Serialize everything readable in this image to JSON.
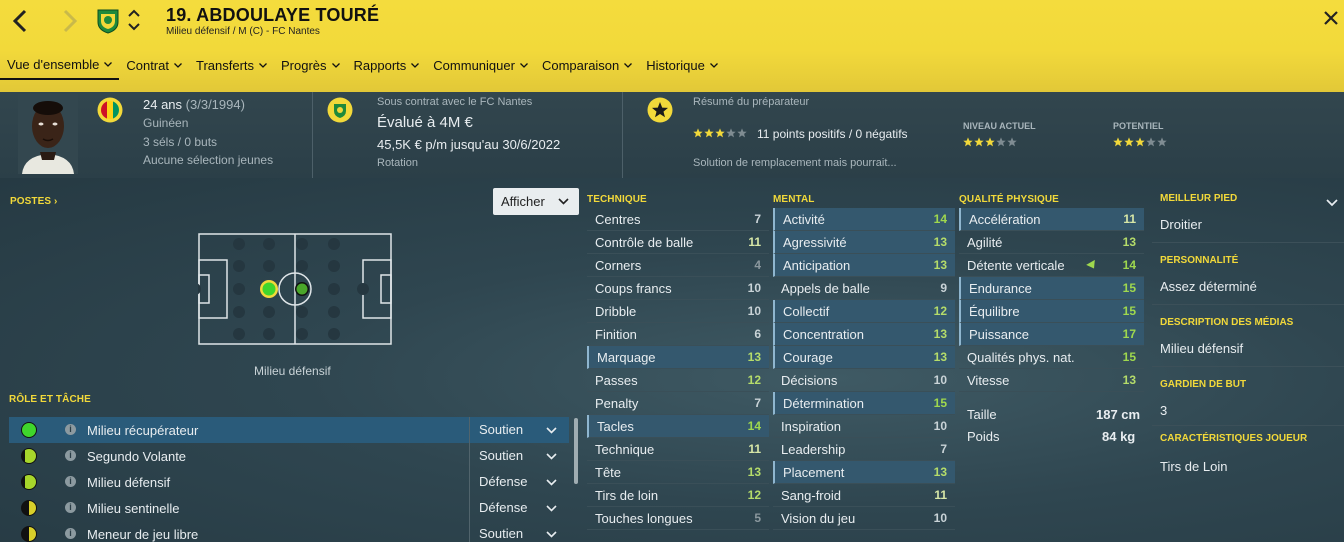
{
  "header": {
    "player_name": "19. ABDOULAYE TOURÉ",
    "player_sub": "Milieu défensif / M (C) - FC Nantes",
    "icons": {
      "back": "chevron-left-icon",
      "forward": "chevron-right-icon",
      "crest": "fc-nantes-crest-icon",
      "updown": "up-down-arrows-icon",
      "close": "close-icon"
    },
    "accent_color": "#f2d93a"
  },
  "menu": [
    {
      "label": "Vue d'ensemble",
      "active": true
    },
    {
      "label": "Contrat"
    },
    {
      "label": "Transferts"
    },
    {
      "label": "Progrès"
    },
    {
      "label": "Rapports"
    },
    {
      "label": "Communiquer"
    },
    {
      "label": "Comparaison"
    },
    {
      "label": "Historique"
    }
  ],
  "info": {
    "age_main": "24 ans",
    "age_dob": "(3/3/1994)",
    "nationality": "Guinéen",
    "caps": "3 séls / 0 buts",
    "youth": "Aucune sélection jeunes",
    "contract_with": "Sous contrat avec le FC Nantes",
    "value": "Évalué à 4M €",
    "wage": "45,5K € p/m jusqu'au 30/6/2022",
    "squad_status": "Rotation",
    "report_title": "Résumé du préparateur",
    "report_stars": 3,
    "report_points": "11 points positifs / 0 négatifs",
    "report_summary": "Solution de remplacement mais pourrait...",
    "current_label": "NIVEAU ACTUEL",
    "current_stars": 3,
    "potential_label": "POTENTIEL",
    "potential_stars": 3
  },
  "positions": {
    "title": "POSTES",
    "show_button": "Afficher",
    "position_label": "Milieu défensif"
  },
  "roles": {
    "title": "RÔLE ET TÂCHE",
    "items": [
      {
        "name": "Milieu récupérateur",
        "duty": "Soutien",
        "selected": true,
        "rating": "full"
      },
      {
        "name": "Segundo Volante",
        "duty": "Soutien",
        "rating": "high"
      },
      {
        "name": "Milieu défensif",
        "duty": "Défense",
        "rating": "high"
      },
      {
        "name": "Milieu sentinelle",
        "duty": "Défense",
        "rating": "half"
      },
      {
        "name": "Meneur de jeu libre",
        "duty": "Soutien",
        "rating": "half"
      }
    ]
  },
  "technique": {
    "title": "TECHNIQUE",
    "items": [
      {
        "name": "Centres",
        "value": 7
      },
      {
        "name": "Contrôle de balle",
        "value": 11
      },
      {
        "name": "Corners",
        "value": 4
      },
      {
        "name": "Coups francs",
        "value": 10
      },
      {
        "name": "Dribble",
        "value": 10
      },
      {
        "name": "Finition",
        "value": 6
      },
      {
        "name": "Marquage",
        "value": 13,
        "highlight": true
      },
      {
        "name": "Passes",
        "value": 12
      },
      {
        "name": "Penalty",
        "value": 7
      },
      {
        "name": "Tacles",
        "value": 14,
        "highlight": true
      },
      {
        "name": "Technique",
        "value": 11
      },
      {
        "name": "Tête",
        "value": 13
      },
      {
        "name": "Tirs de loin",
        "value": 12
      },
      {
        "name": "Touches longues",
        "value": 5
      }
    ]
  },
  "mental": {
    "title": "MENTAL",
    "items": [
      {
        "name": "Activité",
        "value": 14,
        "highlight": true
      },
      {
        "name": "Agressivité",
        "value": 13,
        "highlight": true
      },
      {
        "name": "Anticipation",
        "value": 13,
        "highlight": true
      },
      {
        "name": "Appels de balle",
        "value": 9
      },
      {
        "name": "Collectif",
        "value": 12,
        "highlight": true
      },
      {
        "name": "Concentration",
        "value": 13,
        "highlight": true
      },
      {
        "name": "Courage",
        "value": 13,
        "highlight": true
      },
      {
        "name": "Décisions",
        "value": 10
      },
      {
        "name": "Détermination",
        "value": 15,
        "highlight": true
      },
      {
        "name": "Inspiration",
        "value": 10
      },
      {
        "name": "Leadership",
        "value": 7
      },
      {
        "name": "Placement",
        "value": 13,
        "highlight": true
      },
      {
        "name": "Sang-froid",
        "value": 11
      },
      {
        "name": "Vision du jeu",
        "value": 10
      }
    ]
  },
  "physical": {
    "title": "QUALITÉ PHYSIQUE",
    "items": [
      {
        "name": "Accélération",
        "value": 11,
        "highlight": true
      },
      {
        "name": "Agilité",
        "value": 13
      },
      {
        "name": "Détente verticale",
        "value": 14,
        "trend": "up-arrow-icon"
      },
      {
        "name": "Endurance",
        "value": 15,
        "highlight": true
      },
      {
        "name": "Équilibre",
        "value": 15,
        "highlight": true
      },
      {
        "name": "Puissance",
        "value": 17,
        "highlight": true
      },
      {
        "name": "Qualités phys. nat.",
        "value": 15
      },
      {
        "name": "Vitesse",
        "value": 13
      }
    ],
    "height_label": "Taille",
    "height_value": "187 cm",
    "weight_label": "Poids",
    "weight_value": "84 kg"
  },
  "right_panel": {
    "foot_title": "MEILLEUR PIED",
    "foot_value": "Droitier",
    "personality_title": "PERSONNALITÉ",
    "personality_value": "Assez déterminé",
    "media_title": "DESCRIPTION DES MÉDIAS",
    "media_value": "Milieu défensif",
    "gk_title": "GARDIEN DE BUT",
    "gk_value": "3",
    "traits_title": "CARACTÉRISTIQUES JOUEUR",
    "traits_value": "Tirs de Loin"
  }
}
